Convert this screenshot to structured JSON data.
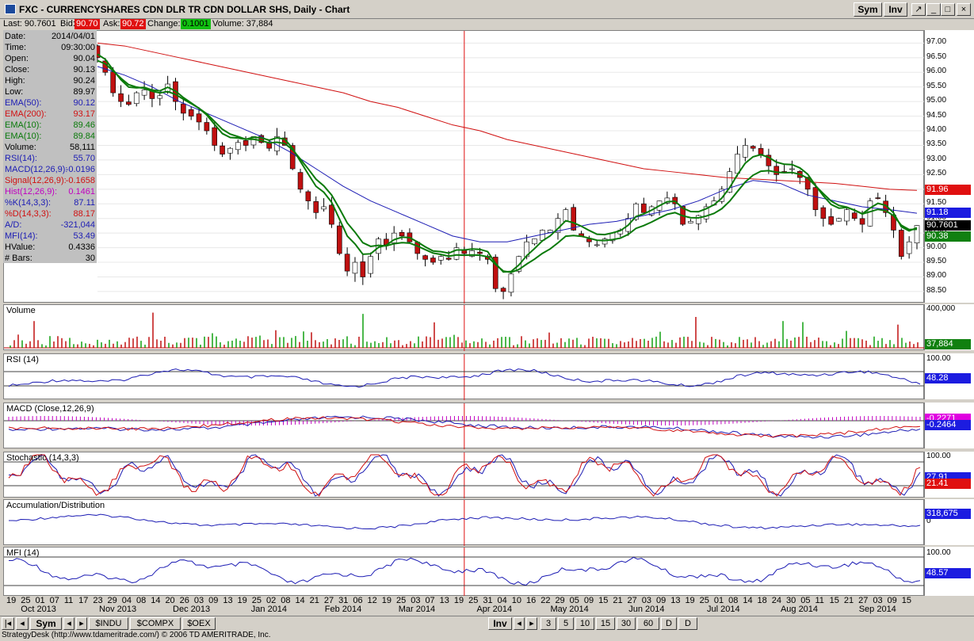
{
  "window": {
    "title": "FXC - CURRENCYSHARES CDN DLR TR CDN DOLLAR SHS, Daily - Chart",
    "sym_btn": "Sym",
    "inv_btn": "Inv",
    "restore": "↗",
    "minimize": "_",
    "maximize": "□",
    "close": "×"
  },
  "quote": {
    "last": "Last: 90.7601",
    "bid_label": "Bid:",
    "bid": "90.70",
    "ask_label": "Ask:",
    "ask": "90.72",
    "change_label": "Change:",
    "change": "0.1001",
    "volume": "Volume: 37,884"
  },
  "info": [
    {
      "k": "Date:",
      "v": "2014/04/01",
      "c": "#000000"
    },
    {
      "k": "Time:",
      "v": "09:30:00",
      "c": "#000000"
    },
    {
      "k": "Open:",
      "v": "90.04",
      "c": "#000000"
    },
    {
      "k": "Close:",
      "v": "90.13",
      "c": "#000000"
    },
    {
      "k": "High:",
      "v": "90.24",
      "c": "#000000"
    },
    {
      "k": "Low:",
      "v": "89.97",
      "c": "#000000"
    },
    {
      "k": "EMA(50):",
      "v": "90.12",
      "c": "#1c1cb4"
    },
    {
      "k": "EMA(200):",
      "v": "93.17",
      "c": "#d01010"
    },
    {
      "k": "EMA(10):",
      "v": "89.46",
      "c": "#0a7a0a"
    },
    {
      "k": "EMA(10):",
      "v": "89.84",
      "c": "#0a7a0a"
    },
    {
      "k": "Volume:",
      "v": "58,111",
      "c": "#000000"
    },
    {
      "k": "RSI(14):",
      "v": "55.70",
      "c": "#1c1cb4"
    },
    {
      "k": "MACD(12,26,9):",
      "v": "-0.0196",
      "c": "#1c1cb4"
    },
    {
      "k": "Signal(12,26,9):",
      "v": "-0.1658",
      "c": "#d01010"
    },
    {
      "k": "Hist(12,26,9):",
      "v": "0.1461",
      "c": "#c000c0"
    },
    {
      "k": "%K(14,3,3):",
      "v": "87.11",
      "c": "#1c1cb4"
    },
    {
      "k": "%D(14,3,3):",
      "v": "88.17",
      "c": "#d01010"
    },
    {
      "k": "A/D:",
      "v": "-321,044",
      "c": "#1c1cb4"
    },
    {
      "k": "MFI(14):",
      "v": "53.49",
      "c": "#1c1cb4"
    },
    {
      "k": "HValue:",
      "v": "0.4336",
      "c": "#000000"
    },
    {
      "k": "# Bars:",
      "v": "30",
      "c": "#000000"
    }
  ],
  "price_axis": [
    "97.00",
    "96.50",
    "96.00",
    "95.50",
    "95.00",
    "94.50",
    "94.00",
    "93.50",
    "93.00",
    "92.50",
    "92.00",
    "91.50",
    "91.00",
    "90.50",
    "90.00",
    "89.50",
    "89.00",
    "88.50"
  ],
  "price_tags": [
    {
      "v": "91.96",
      "c": "#e01010",
      "t": "#ffffff"
    },
    {
      "v": "91.18",
      "c": "#1c1ce0",
      "t": "#ffffff"
    },
    {
      "v": "90.7601",
      "c": "#000000",
      "t": "#ffffff"
    },
    {
      "v": "90.38",
      "c": "#108010",
      "t": "#ffffff"
    }
  ],
  "panes": {
    "volume": {
      "label": "Volume",
      "top_tick": "400,000",
      "value": "37,884",
      "value_color": "#108010"
    },
    "rsi": {
      "label": "RSI (14)",
      "top_tick": "100.00",
      "value": "48.28",
      "value_color": "#1c1ce0"
    },
    "macd": {
      "label": "MACD (Close,12,26,9)",
      "value": "-0.2464",
      "value_color": "#1c1ce0",
      "value2": "-0.2271",
      "value2_color": "#e000e0"
    },
    "stoch": {
      "label": "Stochastic (14,3,3)",
      "top_tick": "100.00",
      "value": "27.91",
      "value_color": "#1c1ce0",
      "value2": "21.41",
      "value2_color": "#e01010"
    },
    "ad": {
      "label": "Accumulation/Distribution",
      "value": "318,675",
      "value_color": "#1c1ce0",
      "zero": "0"
    },
    "mfi": {
      "label": "MFI (14)",
      "top_tick": "100.00",
      "value": "48.57",
      "value_color": "#1c1ce0"
    }
  },
  "x_days": [
    "19",
    "25",
    "01",
    "07",
    "11",
    "17",
    "23",
    "29",
    "04",
    "08",
    "14",
    "20",
    "26",
    "03",
    "09",
    "13",
    "19",
    "25",
    "02",
    "08",
    "14",
    "21",
    "27",
    "31",
    "06",
    "12",
    "19",
    "25",
    "03",
    "07",
    "13",
    "19",
    "25",
    "31",
    "04",
    "10",
    "16",
    "22",
    "29",
    "05",
    "09",
    "15",
    "21",
    "27",
    "03",
    "09",
    "13",
    "19",
    "25",
    "01",
    "08",
    "14",
    "18",
    "24",
    "30",
    "05",
    "11",
    "15",
    "21",
    "27",
    "03",
    "09",
    "15"
  ],
  "x_months": [
    "Oct 2013",
    "Nov 2013",
    "Dec 2013",
    "Jan 2014",
    "Feb 2014",
    "Mar 2014",
    "Apr 2014",
    "May 2014",
    "Jun 2014",
    "Jul 2014",
    "Aug 2014",
    "Sep 2014"
  ],
  "bottom": {
    "sym": "Sym",
    "symbols": [
      "$INDU",
      "$COMPX",
      "$OEX"
    ],
    "inv": "Inv",
    "periods": [
      "3",
      "5",
      "10",
      "15",
      "30",
      "60",
      "D",
      "D"
    ]
  },
  "status": "StrategyDesk (http://www.tdameritrade.com/) © 2006 TD AMERITRADE, Inc.",
  "chart_data": {
    "type": "candlestick",
    "title": "FXC - CURRENCYSHARES CDN DLR TR CDN DOLLAR SHS, Daily - Chart",
    "ylim": [
      88.2,
      97.2
    ],
    "x_range": [
      "2013-09-19",
      "2014-09-16"
    ],
    "close": [
      96.5,
      96.0,
      95.3,
      95.0,
      94.9,
      95.3,
      95.4,
      95.1,
      95.2,
      95.6,
      95.0,
      94.6,
      94.5,
      94.3,
      94.0,
      93.5,
      93.2,
      93.4,
      93.6,
      93.5,
      93.8,
      93.6,
      93.4,
      93.8,
      93.5,
      92.7,
      92.0,
      91.6,
      91.2,
      91.4,
      90.8,
      89.8,
      89.2,
      89.5,
      89.0,
      89.7,
      90.3,
      90.1,
      90.5,
      90.4,
      90.2,
      89.8,
      89.6,
      89.5,
      89.7,
      89.6,
      90.0,
      89.8,
      89.9,
      89.8,
      89.6,
      88.6,
      88.5,
      89.1,
      89.7,
      90.2,
      90.3,
      90.6,
      90.6,
      91.0,
      91.3,
      90.6,
      90.4,
      90.2,
      90.1,
      90.3,
      90.5,
      90.6,
      91.0,
      91.5,
      91.2,
      91.4,
      91.6,
      91.7,
      91.5,
      90.8,
      90.9,
      91.1,
      91.4,
      91.6,
      92.0,
      92.6,
      93.2,
      93.5,
      93.4,
      93.2,
      92.8,
      92.5,
      92.6,
      92.7,
      92.4,
      92.0,
      91.3,
      91.0,
      90.8,
      91.0,
      91.3,
      91.0,
      90.8,
      91.6,
      91.7,
      91.2,
      90.6,
      89.7,
      90.2,
      90.76
    ],
    "ema200": [
      97.0,
      96.9,
      96.7,
      96.5,
      96.3,
      96.1,
      95.9,
      95.7,
      95.5,
      95.3,
      95.0,
      94.8,
      94.5,
      94.2,
      94.0,
      93.7,
      93.5,
      93.3,
      93.1,
      92.9,
      92.7,
      92.6,
      92.5,
      92.4,
      92.35,
      92.3,
      92.25,
      92.2,
      92.1,
      92.0,
      91.96
    ],
    "ema50": [
      96.2,
      95.9,
      95.5,
      95.0,
      94.6,
      94.2,
      93.8,
      93.3,
      92.7,
      92.1,
      91.6,
      91.2,
      90.8,
      90.4,
      90.2,
      90.2,
      90.4,
      90.6,
      90.8,
      90.9,
      91.1,
      91.3,
      91.6,
      92.0,
      92.3,
      92.2,
      91.8,
      91.6,
      91.4,
      91.3,
      91.18
    ]
  }
}
